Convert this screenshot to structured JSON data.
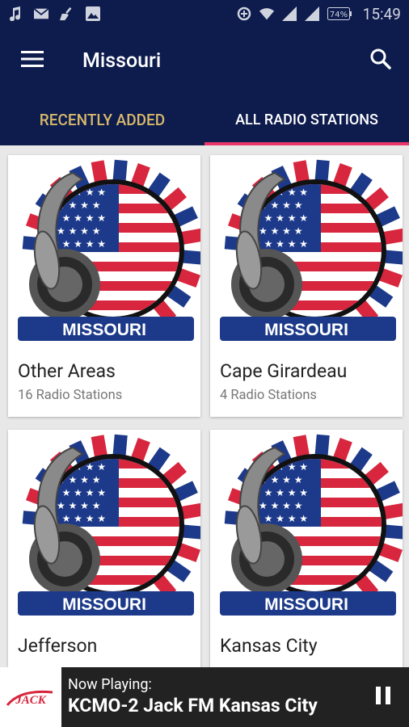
{
  "status_bar": {
    "time": "15:49",
    "battery": "74%",
    "icons": [
      "music-icon",
      "mail-icon",
      "broom-icon",
      "image-icon",
      "data-saver-icon",
      "wifi-icon",
      "signal-icon",
      "signal-icon",
      "battery-icon"
    ]
  },
  "app_bar": {
    "title": "Missouri",
    "menu_icon": "hamburger-icon",
    "search_icon": "search-icon"
  },
  "tabs": [
    {
      "label": "RECENTLY ADDED",
      "selected": false
    },
    {
      "label": "ALL RADIO STATIONS",
      "selected": true
    }
  ],
  "cards": [
    {
      "name": "Other Areas",
      "count": "16 Radio Stations",
      "badge": "MISSOURI"
    },
    {
      "name": "Cape Girardeau",
      "count": "4 Radio Stations",
      "badge": "MISSOURI"
    },
    {
      "name": "Jefferson",
      "count": "",
      "badge": "MISSOURI"
    },
    {
      "name": "Kansas City",
      "count": "",
      "badge": "MISSOURI"
    }
  ],
  "player": {
    "label": "Now Playing:",
    "title": "KCMO-2 Jack FM Kansas City",
    "logo_text": "JACK"
  },
  "colors": {
    "primary": "#0d1b4d",
    "tab_inactive": "#d8b96a",
    "indicator": "#e8356c",
    "player_bg": "#222222"
  }
}
